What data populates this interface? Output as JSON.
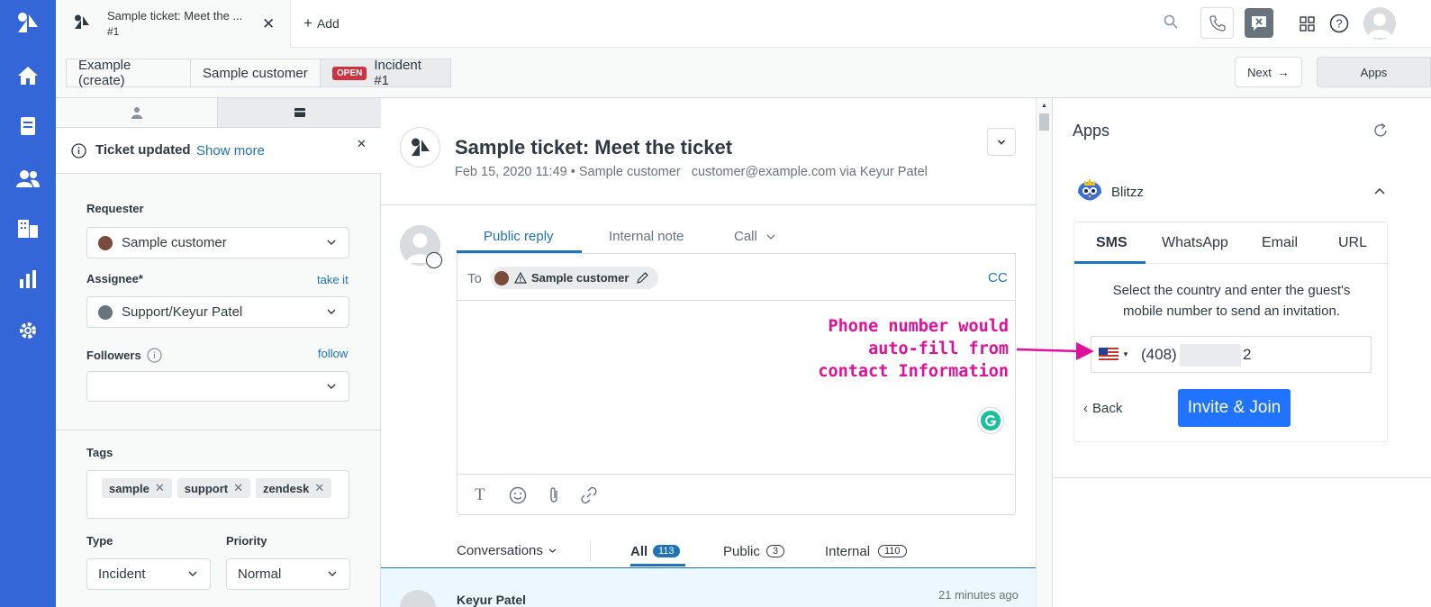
{
  "topbar": {
    "tab_title": "Sample ticket: Meet the ...",
    "tab_sub": "#1",
    "add_label": "Add"
  },
  "breadcrumbs": [
    "Example (create)",
    "Sample customer",
    "Incident #1"
  ],
  "open_badge": "OPEN",
  "next_label": "Next",
  "apps_label": "Apps",
  "notice": {
    "text": "Ticket updated",
    "link": "Show more"
  },
  "fields": {
    "requester_label": "Requester",
    "requester_value": "Sample customer",
    "assignee_label": "Assignee*",
    "assignee_link": "take it",
    "assignee_value": "Support/Keyur Patel",
    "followers_label": "Followers",
    "followers_link": "follow",
    "tags_label": "Tags",
    "tags": [
      "sample",
      "support",
      "zendesk"
    ],
    "type_label": "Type",
    "type_value": "Incident",
    "priority_label": "Priority",
    "priority_value": "Normal"
  },
  "ticket": {
    "title": "Sample ticket: Meet the ticket",
    "meta": "Feb 15, 2020 11:49 • Sample customer   customer@example.com via Keyur Patel"
  },
  "composer": {
    "tabs": [
      "Public reply",
      "Internal note",
      "Call"
    ],
    "to_label": "To",
    "recipient": "Sample customer",
    "cc_label": "CC"
  },
  "annotation": "Phone number would auto-fill from contact Information",
  "conversations": {
    "filter_label": "Conversations",
    "all_label": "All",
    "all_count": "113",
    "public_label": "Public",
    "public_count": "3",
    "internal_label": "Internal",
    "internal_count": "110",
    "partial_author": "Keyur Patel",
    "partial_time": "21 minutes ago"
  },
  "apps_panel": {
    "title": "Apps",
    "app_name": "Blitzz",
    "tabs": [
      "SMS",
      "WhatsApp",
      "Email",
      "URL"
    ],
    "instruction": "Select the country and enter the guest's mobile number to send an invitation.",
    "phone_prefix": "(408)",
    "phone_suffix": "2",
    "back_label": "Back",
    "invite_label": "Invite & Join"
  },
  "colors": {
    "rail": "#3466d8",
    "primary_button": "#1f73ff",
    "annotation": "#e0109a",
    "badge_open": "#cc3340"
  }
}
